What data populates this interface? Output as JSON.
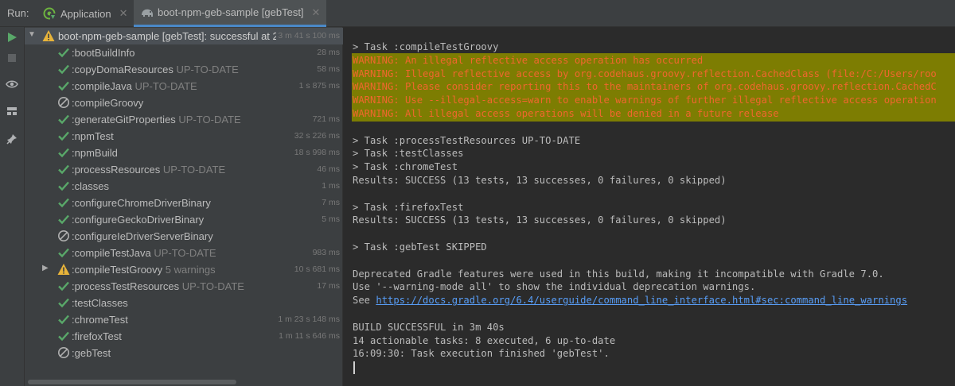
{
  "run_label": "Run:",
  "tabs": [
    {
      "label": "Application",
      "icon": "spring-boot-icon"
    },
    {
      "label": "boot-npm-geb-sample [gebTest]",
      "icon": "gradle-elephant-icon"
    }
  ],
  "tree": {
    "root": {
      "label": "boot-npm-geb-sample [gebTest]:",
      "status_text": " successful at 2",
      "time": "3 m 41 s 100 ms",
      "status": "warning"
    },
    "items": [
      {
        "label": ":bootBuildInfo",
        "extra": "",
        "time": "28 ms",
        "status": "success"
      },
      {
        "label": ":copyDomaResources",
        "extra": " UP-TO-DATE",
        "time": "58 ms",
        "status": "success"
      },
      {
        "label": ":compileJava",
        "extra": " UP-TO-DATE",
        "time": "1 s 875 ms",
        "status": "success"
      },
      {
        "label": ":compileGroovy",
        "extra": "",
        "time": "",
        "status": "skipped"
      },
      {
        "label": ":generateGitProperties",
        "extra": " UP-TO-DATE",
        "time": "721 ms",
        "status": "success"
      },
      {
        "label": ":npmTest",
        "extra": "",
        "time": "32 s 226 ms",
        "status": "success"
      },
      {
        "label": ":npmBuild",
        "extra": "",
        "time": "18 s 998 ms",
        "status": "success"
      },
      {
        "label": ":processResources",
        "extra": " UP-TO-DATE",
        "time": "46 ms",
        "status": "success"
      },
      {
        "label": ":classes",
        "extra": "",
        "time": "1 ms",
        "status": "success"
      },
      {
        "label": ":configureChromeDriverBinary",
        "extra": "",
        "time": "7 ms",
        "status": "success"
      },
      {
        "label": ":configureGeckoDriverBinary",
        "extra": "",
        "time": "5 ms",
        "status": "success"
      },
      {
        "label": ":configureIeDriverServerBinary",
        "extra": "",
        "time": "",
        "status": "skipped"
      },
      {
        "label": ":compileTestJava",
        "extra": " UP-TO-DATE",
        "time": "983 ms",
        "status": "success"
      },
      {
        "label": ":compileTestGroovy",
        "extra": " 5 warnings",
        "time": "10 s 681 ms",
        "status": "warning",
        "collapsible": true
      },
      {
        "label": ":processTestResources",
        "extra": " UP-TO-DATE",
        "time": "17 ms",
        "status": "success"
      },
      {
        "label": ":testClasses",
        "extra": "",
        "time": "",
        "status": "success"
      },
      {
        "label": ":chromeTest",
        "extra": "",
        "time": "1 m 23 s 148 ms",
        "status": "success"
      },
      {
        "label": ":firefoxTest",
        "extra": "",
        "time": "1 m 11 s 646 ms",
        "status": "success"
      },
      {
        "label": ":gebTest",
        "extra": "",
        "time": "",
        "status": "skipped"
      }
    ]
  },
  "console": {
    "lines": [
      {
        "text": "> Task :compileTestGroovy",
        "kind": "normal"
      },
      {
        "text": "WARNING: An illegal reflective access operation has occurred",
        "kind": "warn"
      },
      {
        "text": "WARNING: Illegal reflective access by org.codehaus.groovy.reflection.CachedClass (file:/C:/Users/roo",
        "kind": "warn"
      },
      {
        "text": "WARNING: Please consider reporting this to the maintainers of org.codehaus.groovy.reflection.CachedC",
        "kind": "warn"
      },
      {
        "text": "WARNING: Use --illegal-access=warn to enable warnings of further illegal reflective access operation",
        "kind": "warn"
      },
      {
        "text": "WARNING: All illegal access operations will be denied in a future release",
        "kind": "warn"
      },
      {
        "text": "",
        "kind": "normal"
      },
      {
        "text": "> Task :processTestResources UP-TO-DATE",
        "kind": "normal"
      },
      {
        "text": "> Task :testClasses",
        "kind": "normal"
      },
      {
        "text": "> Task :chromeTest",
        "kind": "normal"
      },
      {
        "text": "Results: SUCCESS (13 tests, 13 successes, 0 failures, 0 skipped)",
        "kind": "normal"
      },
      {
        "text": "",
        "kind": "normal"
      },
      {
        "text": "> Task :firefoxTest",
        "kind": "normal"
      },
      {
        "text": "Results: SUCCESS (13 tests, 13 successes, 0 failures, 0 skipped)",
        "kind": "normal"
      },
      {
        "text": "",
        "kind": "normal"
      },
      {
        "text": "> Task :gebTest SKIPPED",
        "kind": "normal"
      },
      {
        "text": "",
        "kind": "normal"
      },
      {
        "text": "Deprecated Gradle features were used in this build, making it incompatible with Gradle 7.0.",
        "kind": "normal"
      },
      {
        "text": "Use '--warning-mode all' to show the individual deprecation warnings.",
        "kind": "normal"
      },
      {
        "text": "See ",
        "kind": "link",
        "link": "https://docs.gradle.org/6.4/userguide/command_line_interface.html#sec:command_line_warnings"
      },
      {
        "text": "",
        "kind": "normal"
      },
      {
        "text": "BUILD SUCCESSFUL in 3m 40s",
        "kind": "normal"
      },
      {
        "text": "14 actionable tasks: 8 executed, 6 up-to-date",
        "kind": "normal"
      },
      {
        "text": "16:09:30: Task execution finished 'gebTest'.",
        "kind": "normal"
      }
    ]
  },
  "colors": {
    "success": "#59a869",
    "warning": "#e8b43a",
    "skipped": "#b0b0b0",
    "accent": "#4a88c7",
    "warning_text": "#f0672e",
    "warning_bg": "#7d7d02"
  }
}
